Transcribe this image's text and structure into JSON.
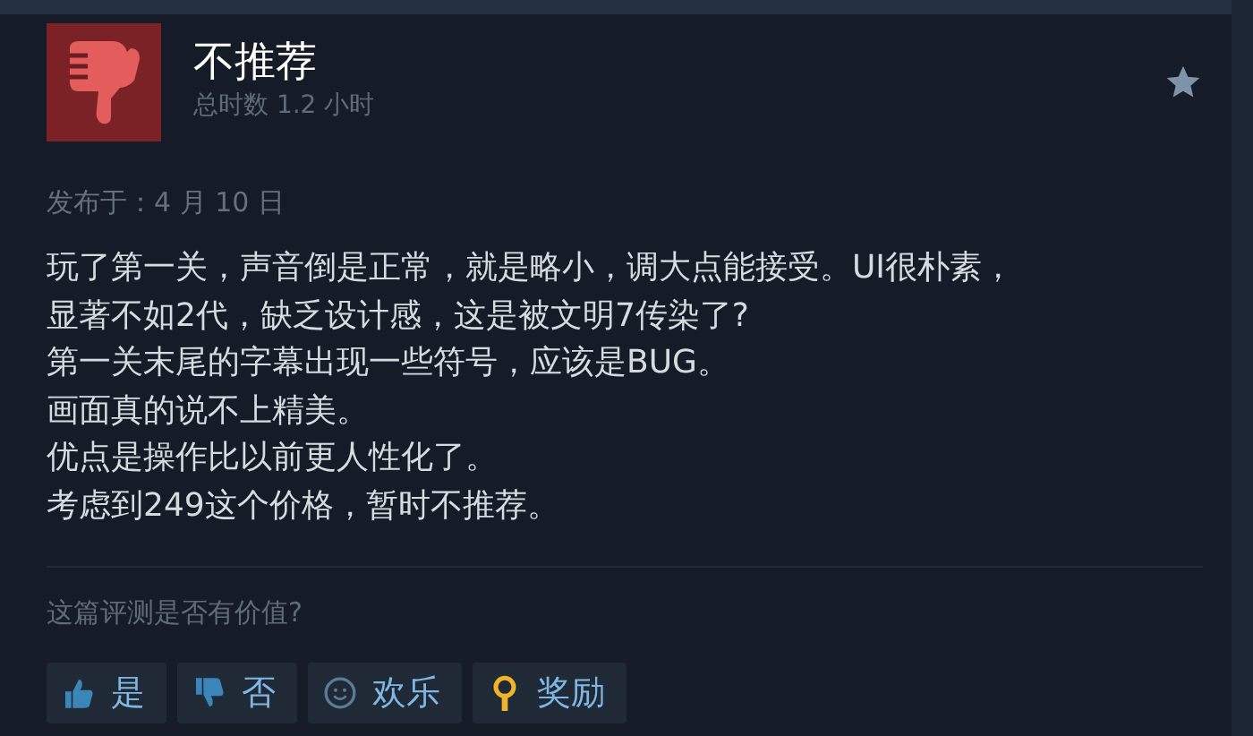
{
  "review": {
    "verdict": "不推荐",
    "playtime": "总时数 1.2 小时",
    "posted": "发布于：4 月 10 日",
    "lines": [
      "玩了第一关，声音倒是正常，就是略小，调大点能接受。UI很朴素，",
      "显著不如2代，缺乏设计感，这是被文明7传染了?",
      "第一关末尾的字幕出现一些符号，应该是BUG。",
      "画面真的说不上精美。",
      "优点是操作比以前更人性化了。",
      "考虑到249这个价格，暂时不推荐。"
    ]
  },
  "helpful": {
    "question": "这篇评测是否有价值?",
    "buttons": [
      {
        "kind": "yes",
        "label": "是"
      },
      {
        "kind": "no",
        "label": "否"
      },
      {
        "kind": "funny",
        "label": "欢乐"
      },
      {
        "kind": "award",
        "label": "奖励"
      }
    ]
  }
}
